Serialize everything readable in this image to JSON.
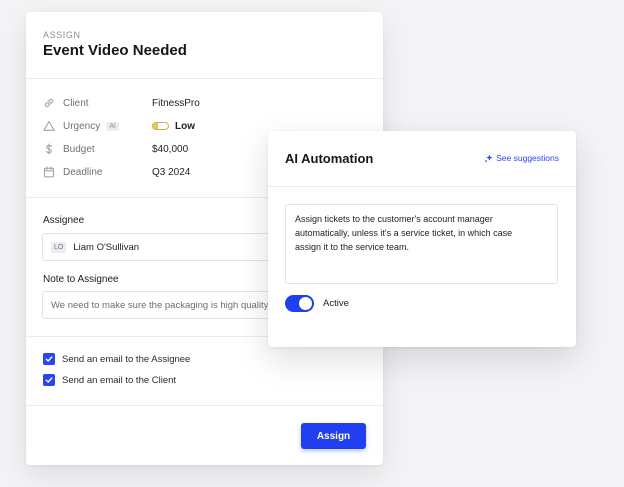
{
  "assign": {
    "eyebrow": "ASSIGN",
    "title": "Event Video Needed",
    "fields": [
      {
        "label": "Client",
        "value": "FitnessPro",
        "icon": "link-icon"
      },
      {
        "label": "Urgency",
        "badge": "AI",
        "value": "Low",
        "icon": "warning-icon"
      },
      {
        "label": "Budget",
        "value": "$40,000",
        "icon": "dollar-icon"
      },
      {
        "label": "Deadline",
        "value": "Q3 2024",
        "icon": "calendar-icon"
      }
    ],
    "assignee_label": "Assignee",
    "assignee_initials": "LO",
    "assignee_name": "Liam O'Sullivan",
    "note_label": "Note to Assignee",
    "note_value": "We need to make sure the packaging is high quality and",
    "checkboxes": [
      {
        "label": "Send an email to the Assignee",
        "checked": true
      },
      {
        "label": "Send an email to the Client",
        "checked": true
      }
    ],
    "assign_button": "Assign"
  },
  "ai_automation": {
    "title": "AI Automation",
    "suggestions_link": "See suggestions",
    "rule_lines": [
      "Assign tickets to the customer's account manager",
      "automatically, unless it's a service ticket, in which case",
      "assign it to the service team."
    ],
    "toggle_label": "Active",
    "toggle_on": true
  },
  "colors": {
    "accent": "#1f3ff0",
    "urgency": "#e7c64a"
  }
}
